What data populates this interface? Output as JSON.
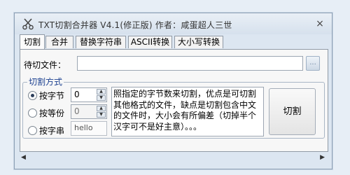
{
  "window": {
    "title": "TXT切割合并器 V4.1(修正版) 作者：咸蛋超人三世",
    "close_glyph": "×"
  },
  "tabs": [
    {
      "label": "切割",
      "active": true
    },
    {
      "label": "合并",
      "active": false
    },
    {
      "label": "替换字符串",
      "active": false
    },
    {
      "label": "ASCII转换",
      "active": false
    },
    {
      "label": "大小写转换",
      "active": false
    }
  ],
  "file": {
    "label": "待切文件：",
    "value": "",
    "browse_label": "..."
  },
  "cut_mode": {
    "title": "切割方式",
    "options": [
      {
        "label": "按字节",
        "checked": true,
        "value": "0"
      },
      {
        "label": "按等份",
        "checked": false,
        "value": "0"
      },
      {
        "label": "按字串",
        "checked": false,
        "value": "hello"
      }
    ],
    "description": "照指定的字节数来切割，优点是可切割其他格式的文件，缺点是切割包含中文的文件时，大小会有所偏差（切掉半个汉字可不是好主意）。。。",
    "cut_button": "切割"
  },
  "icons": {
    "app": "scissors-icon",
    "close": "close-icon",
    "spin_up": "chevron-up-icon",
    "spin_down": "chevron-down-icon",
    "scroll_left": "scroll-left-arrow-icon",
    "scroll_right": "scroll-right-arrow-icon"
  },
  "scroll": {
    "left_glyph": "◀",
    "right_glyph": "▶"
  }
}
